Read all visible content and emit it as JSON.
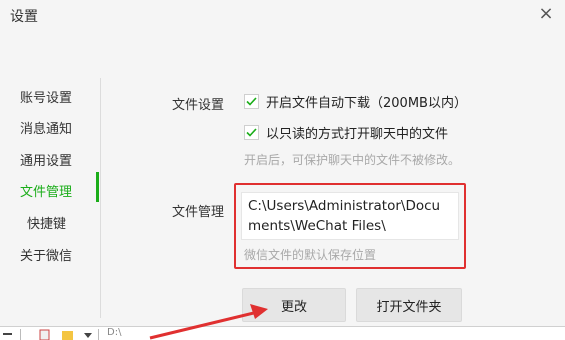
{
  "window": {
    "title": "设置",
    "close_label": "×"
  },
  "sidebar": {
    "items": [
      {
        "label": "账号设置"
      },
      {
        "label": "消息通知"
      },
      {
        "label": "通用设置"
      },
      {
        "label": "文件管理",
        "active": true
      },
      {
        "label": "快捷键"
      },
      {
        "label": "关于微信"
      }
    ]
  },
  "file_settings": {
    "label": "文件设置",
    "options": [
      {
        "label": "开启文件自动下载（200MB以内）",
        "checked": true
      },
      {
        "label": "以只读的方式打开聊天中的文件",
        "checked": true
      }
    ],
    "hint": "开启后，可保护聊天中的文件不被修改。"
  },
  "file_management": {
    "label": "文件管理",
    "path_line1": "C:\\Users\\Administrator\\Docu",
    "path_line2": "ments\\WeChat Files\\",
    "path_hint": "微信文件的默认保存位置"
  },
  "buttons": {
    "change_label": "更改",
    "open_folder_label": "打开文件夹"
  },
  "taskbar": {
    "path_text": "D:\\"
  },
  "colors": {
    "accent": "#1aad19",
    "highlight": "#e03030"
  }
}
